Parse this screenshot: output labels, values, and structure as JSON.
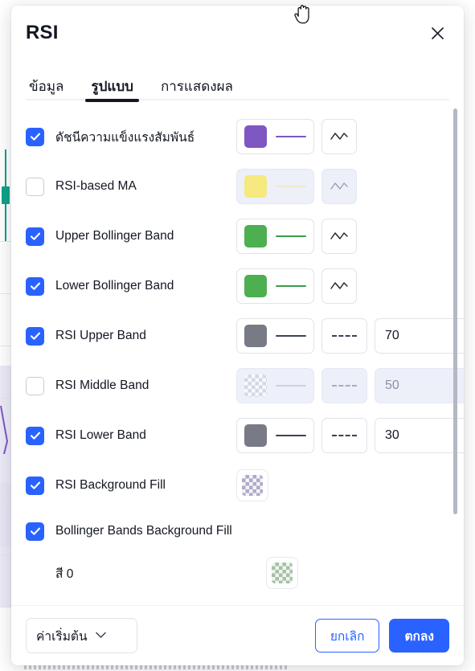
{
  "window": {
    "title": "RSI",
    "close_icon": "close-icon",
    "cursor_icon": "grab-hand-cursor"
  },
  "tabs": [
    {
      "label": "ข้อมูล",
      "active": false
    },
    {
      "label": "รูปแบบ",
      "active": true
    },
    {
      "label": "การแสดงผล",
      "active": false
    }
  ],
  "colors": {
    "accent": "#2962ff",
    "rsi_line": "#7e57c2",
    "rsi_ma_line": "#f5e97f",
    "bollinger": "#4caf50",
    "band_gray": "#787b86",
    "text": "#131722",
    "border": "#e0e3eb",
    "disabled_bg": "#edf0f9"
  },
  "rows": [
    {
      "name": "relative-strength-index",
      "label": "ดัชนีความแข็งแรงสัมพันธ์",
      "checked": true,
      "enabled": true,
      "color": "#7e57c2",
      "line_color": "#7e57c2",
      "has_style_icon": true,
      "style_icon": "wave-line-icon"
    },
    {
      "name": "rsi-based-ma",
      "label": "RSI-based MA",
      "checked": false,
      "enabled": false,
      "color": "#f5e97f",
      "line_color": "#f0e38f",
      "has_style_icon": true,
      "style_icon": "wave-line-icon"
    },
    {
      "name": "upper-bollinger-band",
      "label": "Upper Bollinger Band",
      "checked": true,
      "enabled": true,
      "color": "#4caf50",
      "line_color": "#3a9a4a",
      "has_style_icon": true,
      "style_icon": "wave-line-icon"
    },
    {
      "name": "lower-bollinger-band",
      "label": "Lower Bollinger Band",
      "checked": true,
      "enabled": true,
      "color": "#4caf50",
      "line_color": "#3a9a4a",
      "has_style_icon": true,
      "style_icon": "wave-line-icon"
    },
    {
      "name": "rsi-upper-band",
      "label": "RSI Upper Band",
      "checked": true,
      "enabled": true,
      "color": "#787b86",
      "line_color": "#3b4254",
      "has_dash": true,
      "dash_icon": "dashed-line-icon",
      "value": "70"
    },
    {
      "name": "rsi-middle-band",
      "label": "RSI Middle Band",
      "checked": false,
      "enabled": false,
      "color": "transparent",
      "line_color": "#a7adbe",
      "has_dash": true,
      "dash_icon": "dashed-line-icon",
      "value": "50"
    },
    {
      "name": "rsi-lower-band",
      "label": "RSI Lower Band",
      "checked": true,
      "enabled": true,
      "color": "#787b86",
      "line_color": "#3b4254",
      "has_dash": true,
      "dash_icon": "dashed-line-icon",
      "value": "30"
    },
    {
      "name": "rsi-background-fill",
      "label": "RSI Background Fill",
      "checked": true,
      "enabled": true,
      "fill_swatch": "#b0aac6",
      "fill_swatch_bg": "#f4f2fa"
    },
    {
      "name": "bollinger-bands-background-fill",
      "label": "Bollinger Bands Background Fill",
      "checked": true,
      "enabled": true
    },
    {
      "name": "color-0",
      "label": "สี 0",
      "sub": true,
      "fill_swatch": "#a8bfa8",
      "fill_swatch_bg": "#eef6ee"
    }
  ],
  "footer": {
    "defaults_label": "ค่าเริ่มต้น",
    "defaults_icon": "chevron-down-icon",
    "cancel_label": "ยกเลิก",
    "ok_label": "ตกลง"
  }
}
